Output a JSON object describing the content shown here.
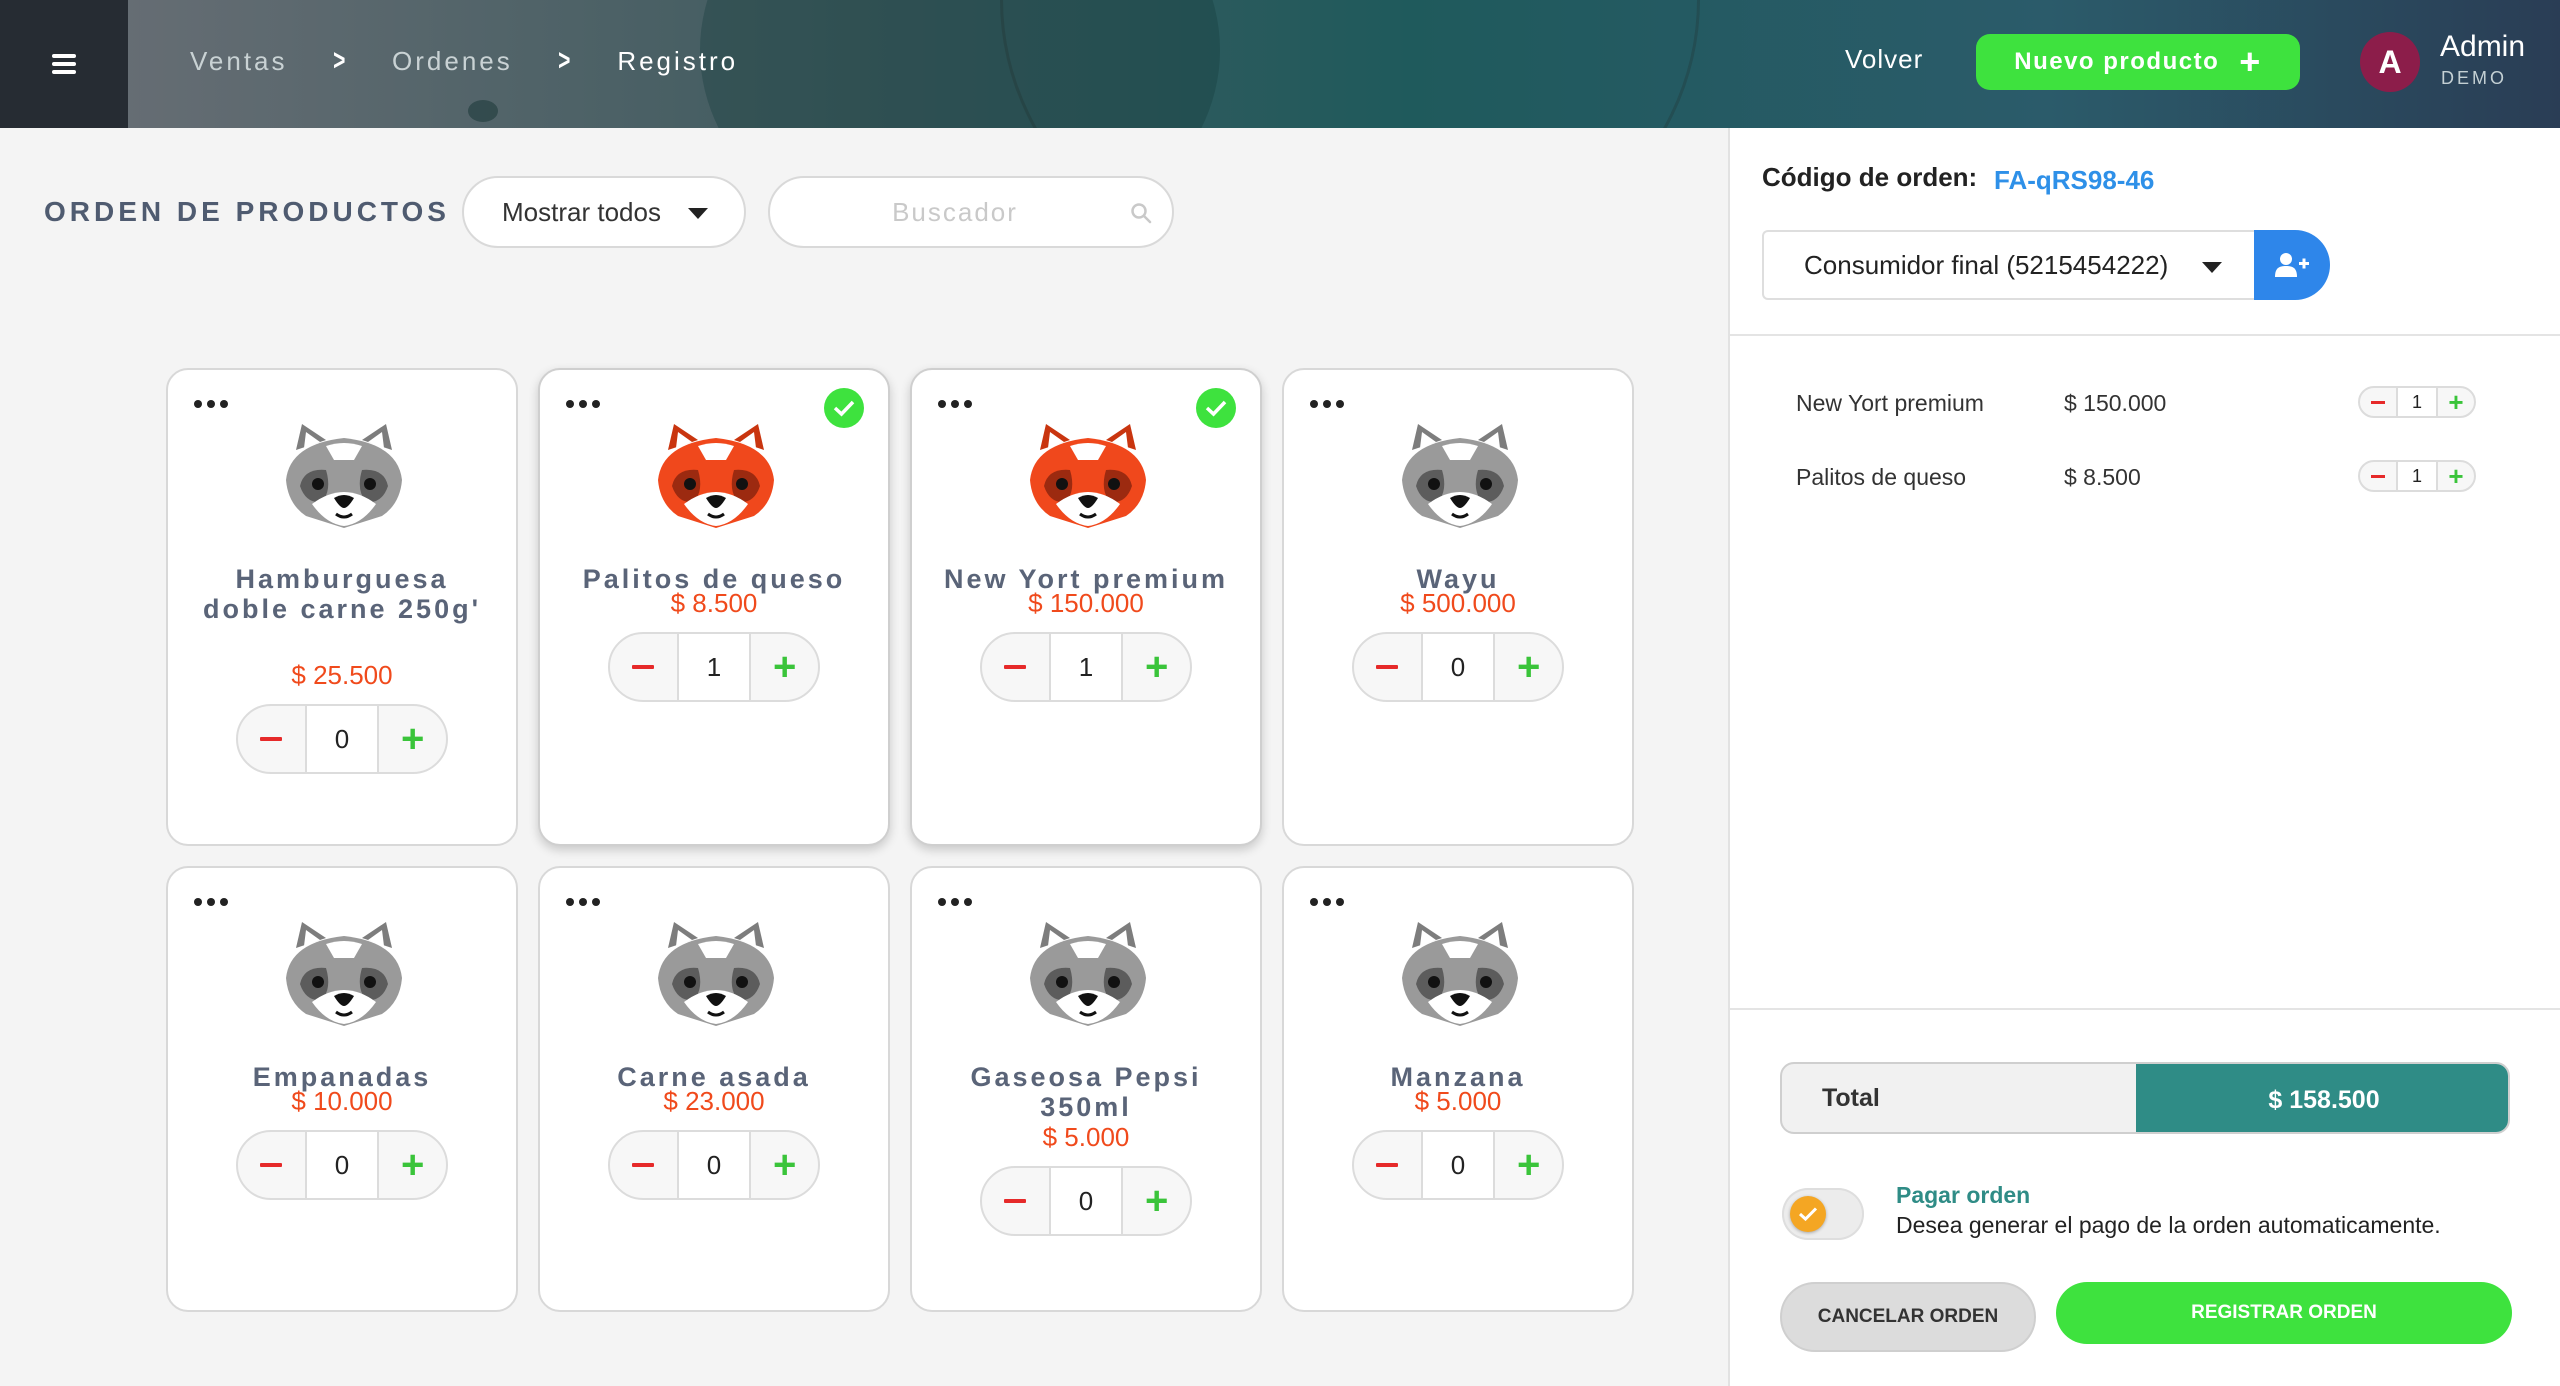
{
  "header": {
    "breadcrumbs": [
      "Ventas",
      "Ordenes",
      "Registro"
    ],
    "back_label": "Volver",
    "new_product_label": "Nuevo producto",
    "user": {
      "initial": "A",
      "name": "Admin",
      "role": "DEMO"
    }
  },
  "catalog": {
    "title": "ORDEN DE PRODUCTOS",
    "filter_value": "Mostrar todos",
    "search_placeholder": "Buscador",
    "products": [
      {
        "name": "Hamburguesa doble carne 250g'",
        "price": "$ 25.500",
        "qty": "0",
        "selected": false
      },
      {
        "name": "Palitos de queso",
        "price": "$ 8.500",
        "qty": "1",
        "selected": true
      },
      {
        "name": "New Yort premium",
        "price": "$ 150.000",
        "qty": "1",
        "selected": true
      },
      {
        "name": "Wayu",
        "price": "$ 500.000",
        "qty": "0",
        "selected": false
      },
      {
        "name": "Empanadas",
        "price": "$ 10.000",
        "qty": "0",
        "selected": false
      },
      {
        "name": "Carne asada",
        "price": "$ 23.000",
        "qty": "0",
        "selected": false
      },
      {
        "name": "Gaseosa Pepsi 350ml",
        "price": "$ 5.000",
        "qty": "0",
        "selected": false
      },
      {
        "name": "Manzana",
        "price": "$ 5.000",
        "qty": "0",
        "selected": false
      }
    ]
  },
  "order": {
    "code_label": "Código de orden:",
    "code_value": "FA-qRS98-46",
    "client": "Consumidor final (5215454222)",
    "lines": [
      {
        "name": "New Yort premium",
        "price": "$ 150.000",
        "qty": "1"
      },
      {
        "name": "Palitos de queso",
        "price": "$ 8.500",
        "qty": "1"
      }
    ],
    "total_label": "Total",
    "total_value": "$ 158.500",
    "pay_title": "Pagar orden",
    "pay_desc": "Desea generar el pago de la orden automaticamente.",
    "pay_enabled": true,
    "cancel_label": "CANCELAR ORDEN",
    "register_label": "REGISTRAR ORDEN"
  },
  "colors": {
    "accent_green": "#3ee23e",
    "price_red": "#f04a1c",
    "link_blue": "#2e90e8",
    "teal": "#2f8c86",
    "selected_mascot": "red-panda-red",
    "unselected_mascot": "red-panda-gray"
  }
}
